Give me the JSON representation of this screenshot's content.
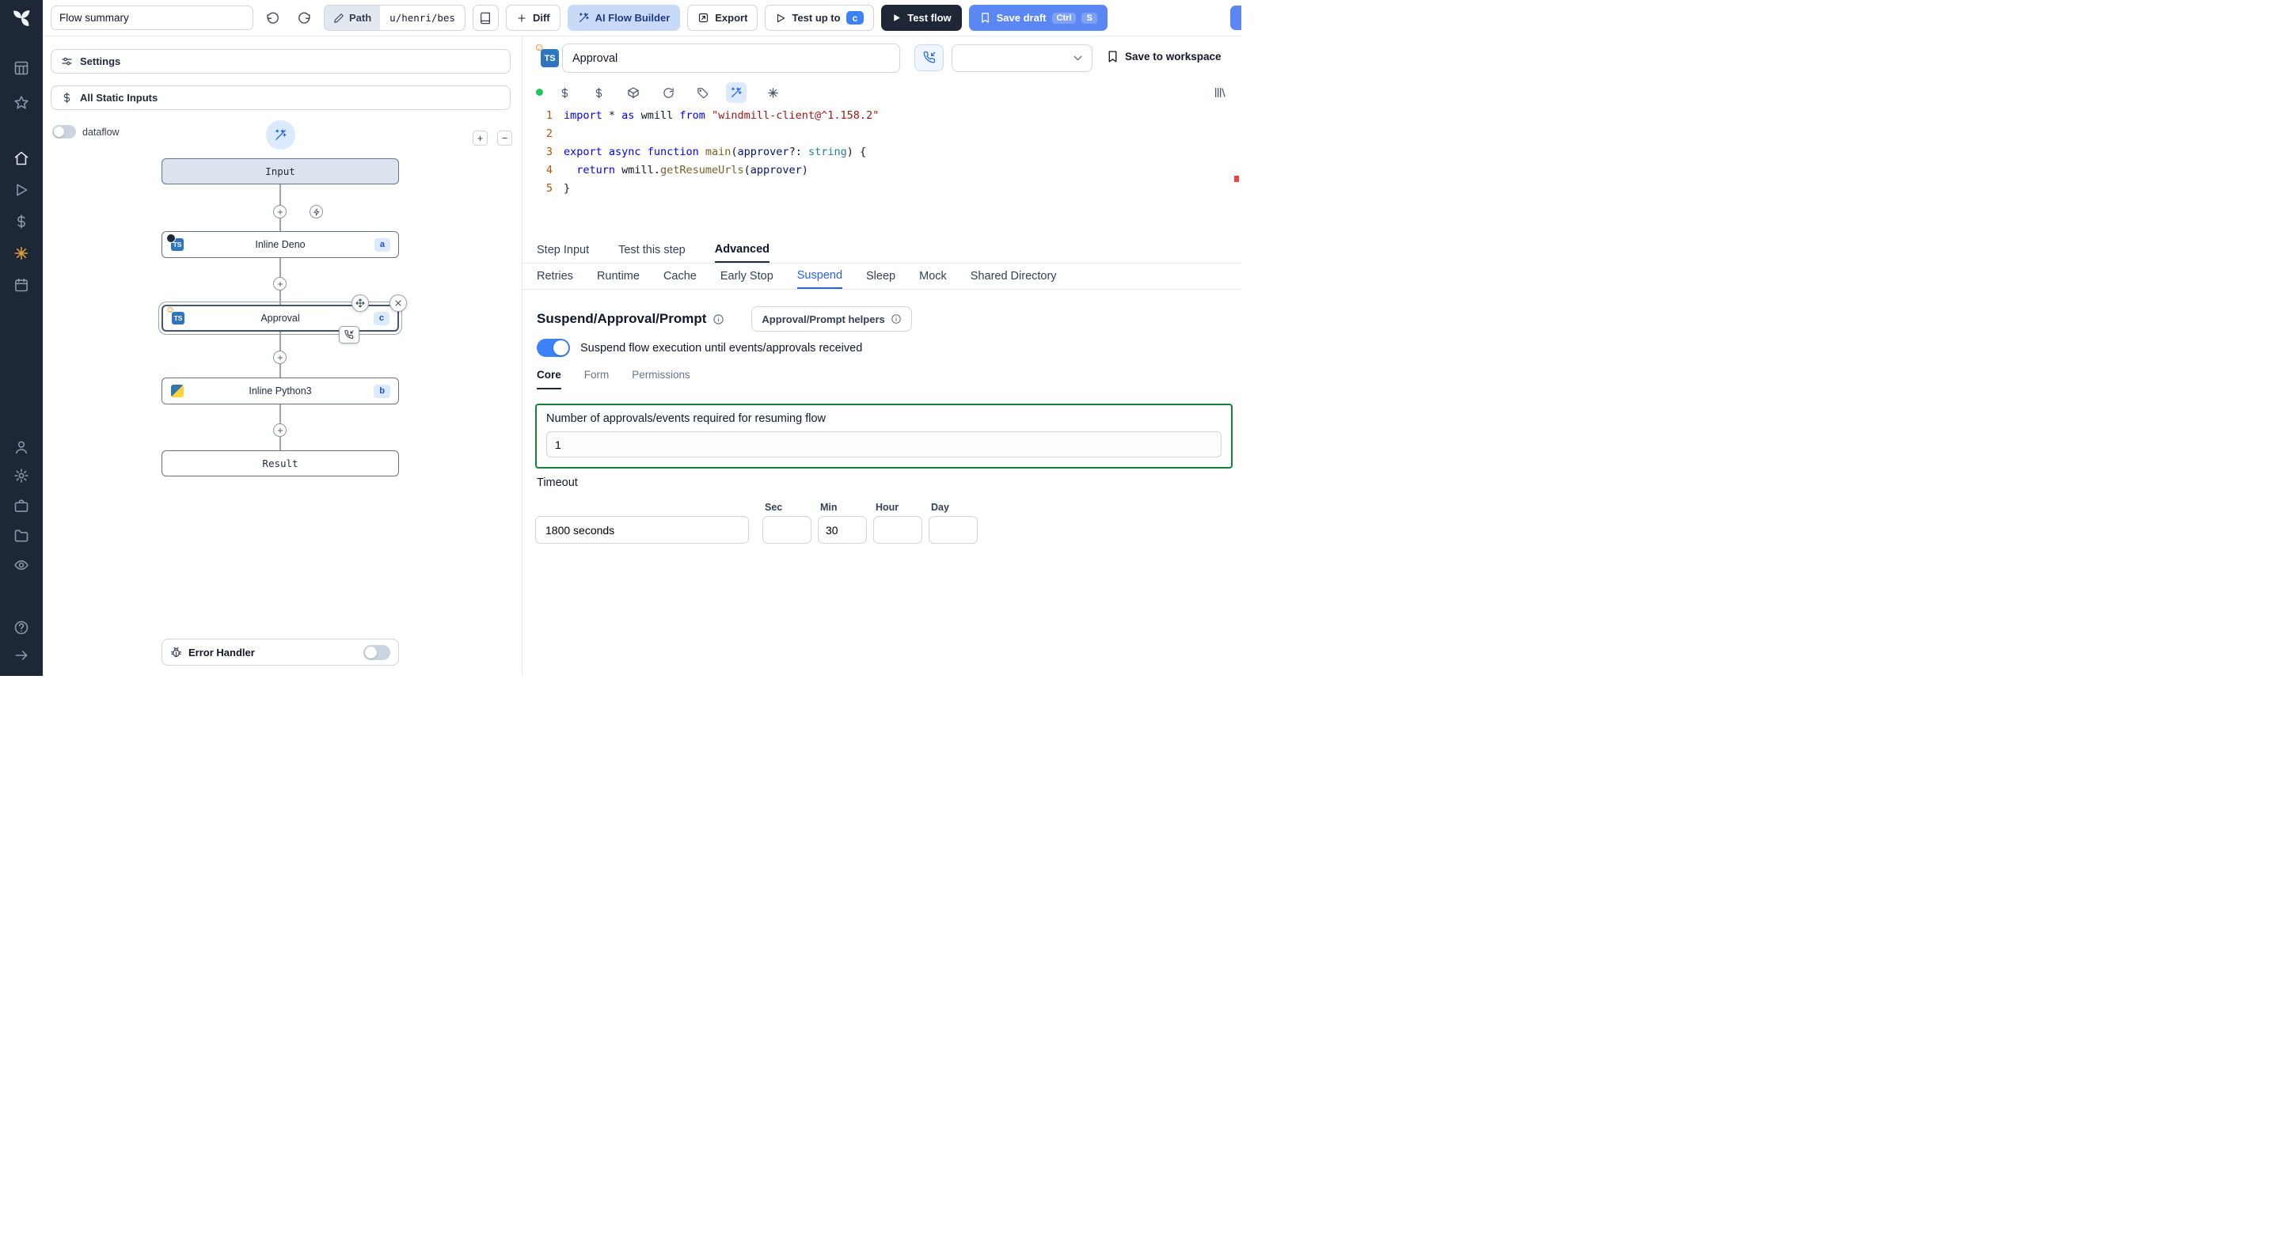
{
  "colors": {
    "sidebar_bg": "#1e2736",
    "accent_blue": "#2563eb",
    "save_draft_blue": "#5b87f5",
    "ai_builder_bg": "#c9daf8",
    "suspend_border_green": "#15803d",
    "toggle_on_blue": "#3b82f6",
    "status_green": "#22c55e",
    "editor_keyword": "#0000ff",
    "editor_string": "#a31515"
  },
  "topbar": {
    "flow_summary_value": "Flow summary",
    "path_chip": "Path",
    "path_value": "u/henri/bes",
    "diff_label": "Diff",
    "ai_flow_builder_label": "AI Flow Builder",
    "export_label": "Export",
    "test_up_to_label": "Test up to",
    "test_up_to_badge": "c",
    "test_flow_label": "Test flow",
    "save_draft_label": "Save draft",
    "save_draft_kbd_1": "Ctrl",
    "save_draft_kbd_2": "S"
  },
  "sidebar_icons": [
    "windmill-logo",
    "grid",
    "star",
    "home",
    "play",
    "dollar",
    "hub",
    "calendar",
    "user",
    "settings",
    "workers",
    "folders",
    "eye",
    "help",
    "expand"
  ],
  "flow_panel": {
    "settings_label": "Settings",
    "static_inputs_label": "All Static Inputs",
    "dataflow_label": "dataflow",
    "zoom_in_label": "+",
    "zoom_out_label": "−",
    "nodes": {
      "input_label": "Input",
      "deno_label": "Inline Deno",
      "deno_badge": "a",
      "approval_label": "Approval",
      "approval_badge": "c",
      "python_label": "Inline Python3",
      "python_badge": "b",
      "result_label": "Result"
    },
    "error_handler_label": "Error Handler"
  },
  "step_editor": {
    "language_icon_text": "TS",
    "name_value": "Approval",
    "save_to_workspace_label": "Save to workspace",
    "code": {
      "line_numbers": [
        "1",
        "2",
        "3",
        "4",
        "5"
      ],
      "lines": [
        [
          {
            "c": "kw",
            "t": "import"
          },
          {
            "c": "pl",
            "t": " * "
          },
          {
            "c": "kw",
            "t": "as"
          },
          {
            "c": "pl",
            "t": " wmill "
          },
          {
            "c": "kw",
            "t": "from"
          },
          {
            "c": "pl",
            "t": " "
          },
          {
            "c": "str",
            "t": "\"windmill-client@^1.158.2\""
          }
        ],
        [],
        [
          {
            "c": "kw",
            "t": "export"
          },
          {
            "c": "pl",
            "t": " "
          },
          {
            "c": "kw",
            "t": "async"
          },
          {
            "c": "pl",
            "t": " "
          },
          {
            "c": "kw",
            "t": "function"
          },
          {
            "c": "pl",
            "t": " "
          },
          {
            "c": "fn",
            "t": "main"
          },
          {
            "c": "pl",
            "t": "("
          },
          {
            "c": "var",
            "t": "approver"
          },
          {
            "c": "pl",
            "t": "?: "
          },
          {
            "c": "type",
            "t": "string"
          },
          {
            "c": "pl",
            "t": ") {"
          }
        ],
        [
          {
            "c": "pl",
            "t": "  "
          },
          {
            "c": "kw",
            "t": "return"
          },
          {
            "c": "pl",
            "t": " wmill."
          },
          {
            "c": "fn",
            "t": "getResumeUrls"
          },
          {
            "c": "pl",
            "t": "("
          },
          {
            "c": "var",
            "t": "approver"
          },
          {
            "c": "pl",
            "t": ")"
          }
        ],
        [
          {
            "c": "pl",
            "t": "}"
          }
        ]
      ]
    }
  },
  "tabs": {
    "primary": [
      {
        "label": "Step Input"
      },
      {
        "label": "Test this step"
      },
      {
        "label": "Advanced"
      }
    ],
    "primary_active": "Advanced",
    "secondary": [
      {
        "label": "Retries"
      },
      {
        "label": "Runtime"
      },
      {
        "label": "Cache"
      },
      {
        "label": "Early Stop"
      },
      {
        "label": "Suspend"
      },
      {
        "label": "Sleep"
      },
      {
        "label": "Mock"
      },
      {
        "label": "Shared Directory"
      }
    ],
    "secondary_active": "Suspend"
  },
  "suspend_section": {
    "title": "Suspend/Approval/Prompt",
    "helpers_button_label": "Approval/Prompt helpers",
    "toggle_label": "Suspend flow execution until events/approvals received",
    "sub_tabs": [
      {
        "label": "Core"
      },
      {
        "label": "Form"
      },
      {
        "label": "Permissions"
      }
    ],
    "sub_tab_active": "Core",
    "approvals_label": "Number of approvals/events required for resuming flow",
    "approvals_value": "1",
    "timeout_label": "Timeout",
    "timeout_value": "1800 seconds",
    "unit_headers": [
      "Sec",
      "Min",
      "Hour",
      "Day"
    ],
    "sec_value": "",
    "min_value": "30",
    "hour_value": "",
    "day_value": ""
  }
}
